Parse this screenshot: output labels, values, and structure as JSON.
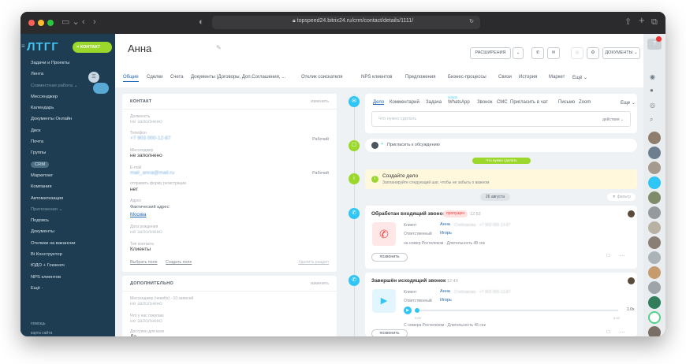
{
  "browser": {
    "url": "topspeed24.bitrix24.ru/crm/contact/details/1111/"
  },
  "sidebar": {
    "logo": "ЛТГГ",
    "contact_button": "× КОНТАКТ",
    "items": [
      {
        "label": "Задачи и Проекты"
      },
      {
        "label": "Лента"
      },
      {
        "label": "Совместная работа ⌄"
      },
      {
        "label": "Мессенджер"
      },
      {
        "label": "Календарь"
      },
      {
        "label": "Документы Онлайн"
      },
      {
        "label": "Диск"
      },
      {
        "label": "Почта"
      },
      {
        "label": "Группы"
      },
      {
        "label": "CRM"
      },
      {
        "label": "Маркетинг"
      },
      {
        "label": "Компания"
      },
      {
        "label": "Автоматизация"
      },
      {
        "label": "Приложения ⌄"
      },
      {
        "label": "Подпись"
      },
      {
        "label": "Документы"
      },
      {
        "label": "Отклики на вакансии"
      },
      {
        "label": "Bi Конструктор"
      },
      {
        "label": "ЮДО + Гоюкноч"
      },
      {
        "label": "NPS клиентов"
      },
      {
        "label": "Ещё ·"
      }
    ],
    "footer_help": "помощь",
    "footer_map": "карта сайта"
  },
  "header": {
    "title": "Анна",
    "btn_extensions": "РАСШИРЕНИЯ",
    "btn_documents": "ДОКУМЕНТЫ ⌄"
  },
  "tabs": [
    "Общие",
    "Сделки",
    "Счета",
    "Документы (Договоры, Доп.Соглашения, ...",
    "Отклик соискателя",
    "NPS клиентов",
    "Предложения",
    "Бизнес-процессы",
    "Связи",
    "История",
    "Маркет",
    "Ещё ⌄"
  ],
  "contact": {
    "section_title": "КОНТАКТ",
    "edit": "изменить",
    "fields": [
      {
        "label": "Должность",
        "value": "не заполнено"
      },
      {
        "label": "Телефон",
        "value": "+7 903 000-12-87",
        "right": "Рабочий"
      },
      {
        "label": "Мессенджер",
        "value": "не заполнено"
      },
      {
        "label": "E-mail",
        "value": "mail_anna@mail.ru",
        "right": "Рабочий"
      },
      {
        "label": "отправить форму регистрации",
        "value": "нет"
      },
      {
        "label": "Адрес",
        "value": "Фактический адрес:"
      },
      {
        "label": "",
        "value": "Москва"
      },
      {
        "label": "Дата рождения",
        "value": "не заполнено"
      },
      {
        "label": "Тип контакта",
        "value": "Клиенты"
      }
    ],
    "select_field": "Выбрать поле",
    "create_field": "Создать поле",
    "delete_section": "Удалить раздел"
  },
  "extra": {
    "section_title": "ДОПОЛНИТЕЛЬНО",
    "edit": "изменить",
    "fields": [
      {
        "label": "Мессенджер (чекибо) - 10 записей",
        "value": "не заполнено"
      },
      {
        "label": "Что у нас покупаю",
        "value": "не заполнено"
      },
      {
        "label": "Доступен для всех",
        "value": "Да"
      }
    ]
  },
  "timeline": {
    "actions": [
      "Дело",
      "Комментарий",
      "Задача",
      "WhatsApp",
      "Звонок",
      "СМС",
      "Пригласить в чат",
      "Письмо",
      "Zoom",
      "Еще ⌄"
    ],
    "new_badge": "НОВОЕ",
    "todo_placeholder": "Что нужно сделать",
    "todo_actions": "действия ⌄",
    "invite": "Пригласить к обсуждению",
    "todo_pill": "Что нужно сделать",
    "create_title": "Создайте дело",
    "create_sub": "Запланируйте следующий шаг, чтобы не забыть о важном",
    "date_pill": "26 августа",
    "filter": "фильтр",
    "call1": {
      "title": "Обработан входящий звонок",
      "badge": "пропущен",
      "time": "12:52",
      "client_label": "Клиент",
      "client_name": "Анна",
      "responsible_label": "Ответственный",
      "responsible_name": "Игорь",
      "line": "на номер Ростелеком · Длительность 48 сек",
      "call_btn": "позвонить"
    },
    "call2": {
      "title": "Завершён исходящий звонок",
      "time": "12:49",
      "client_label": "Клиент",
      "client_name": "Анна",
      "responsible_label": "Ответственный",
      "responsible_name": "Игорь",
      "speed": "1.0x",
      "t_start": "0:00",
      "t_end": "0:42",
      "line": "С номера Ростелеком · Длительность 45 сек",
      "call_btn": "позвонить"
    }
  },
  "colors": {
    "accent": "#2066b0",
    "green": "#9cd82c",
    "timeline_blue": "#2fc6f6"
  }
}
